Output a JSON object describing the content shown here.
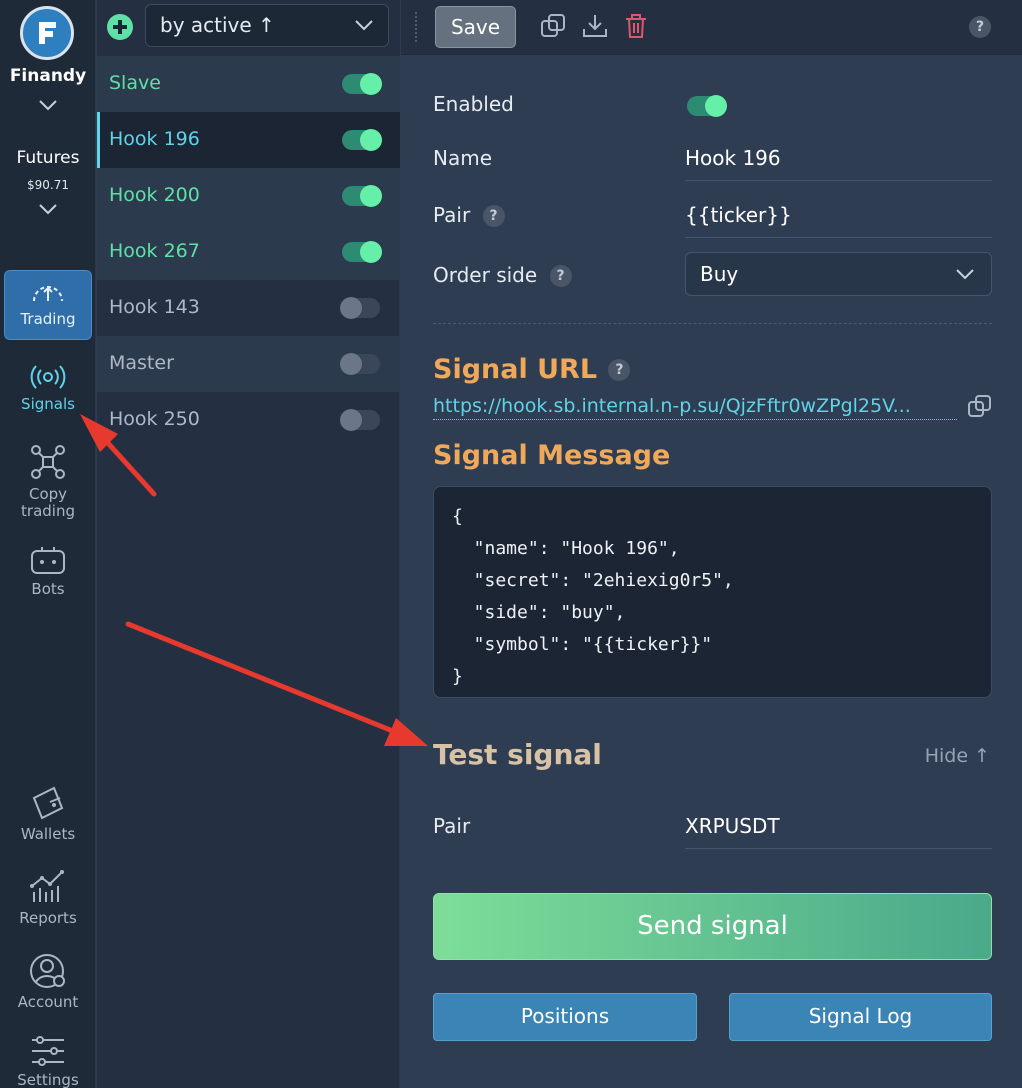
{
  "nav": {
    "brand": "Finandy",
    "account_type": "Futures",
    "balance": "$90.71",
    "items": [
      {
        "label": "Trading",
        "icon": "gauge-icon"
      },
      {
        "label": "Signals",
        "icon": "broadcast-icon"
      },
      {
        "label_line1": "Copy",
        "label_line2": "trading",
        "icon": "network-icon"
      },
      {
        "label": "Bots",
        "icon": "robot-icon"
      },
      {
        "label": "Wallets",
        "icon": "wallet-icon"
      },
      {
        "label": "Reports",
        "icon": "chart-icon"
      },
      {
        "label": "Account",
        "icon": "user-gear-icon"
      },
      {
        "label": "Settings",
        "icon": "sliders-icon"
      }
    ]
  },
  "list": {
    "sort_label": "by active ↑",
    "hooks": [
      {
        "name": "Slave",
        "enabled": true
      },
      {
        "name": "Hook 196",
        "enabled": true
      },
      {
        "name": "Hook 200",
        "enabled": true
      },
      {
        "name": "Hook 267",
        "enabled": true
      },
      {
        "name": "Hook 143",
        "enabled": false
      },
      {
        "name": "Master",
        "enabled": false
      },
      {
        "name": "Hook 250",
        "enabled": false
      }
    ]
  },
  "toolbar": {
    "save_label": "Save",
    "help": "?"
  },
  "form": {
    "enabled_label": "Enabled",
    "name_label": "Name",
    "name_value": "Hook 196",
    "pair_label": "Pair",
    "pair_value": "{{ticker}}",
    "order_side_label": "Order side",
    "order_side_value": "Buy",
    "help": "?"
  },
  "signal": {
    "url_heading": "Signal URL",
    "url": "https://hook.sb.internal.n-p.su/QjzFftr0wZPgl25V...",
    "message_heading": "Signal Message",
    "message_lines": [
      "{",
      "  \"name\": \"Hook 196\",",
      "  \"secret\": \"2ehiexig0r5\",",
      "  \"side\": \"buy\",",
      "  \"symbol\": \"{{ticker}}\"",
      "}"
    ]
  },
  "test": {
    "title": "Test signal",
    "hide_label": "Hide ↑",
    "pair_label": "Pair",
    "pair_value": "XRPUSDT",
    "send_label": "Send signal",
    "positions_label": "Positions",
    "log_label": "Signal Log"
  },
  "colors": {
    "accent_green": "#5fe0a6",
    "accent_cyan": "#5fd3e8",
    "heading_orange": "#f0a85a"
  }
}
